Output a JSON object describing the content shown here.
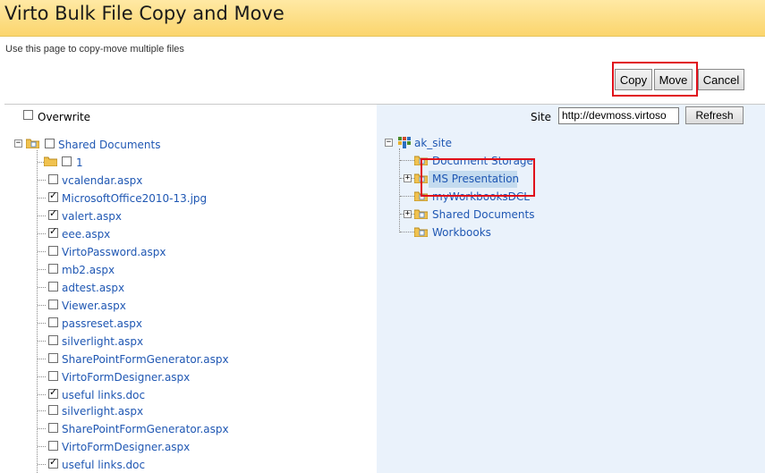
{
  "title": "Virto Bulk File Copy and Move",
  "subtitle": "Use this page to copy-move multiple files",
  "buttons": {
    "copy": "Copy",
    "move": "Move",
    "cancel": "Cancel"
  },
  "overwrite": {
    "label": "Overwrite",
    "checked": false
  },
  "site": {
    "label": "Site",
    "value": "http://devmoss.virtoso",
    "refresh": "Refresh"
  },
  "left_tree": {
    "root": "Shared Documents",
    "folder_1": "1",
    "files": [
      {
        "name": "vcalendar.aspx",
        "checked": false
      },
      {
        "name": "MicrosoftOffice2010-13.jpg",
        "checked": true
      },
      {
        "name": "valert.aspx",
        "checked": true
      },
      {
        "name": "eee.aspx",
        "checked": true
      },
      {
        "name": "VirtoPassword.aspx",
        "checked": false
      },
      {
        "name": "mb2.aspx",
        "checked": false
      },
      {
        "name": "adtest.aspx",
        "checked": false
      },
      {
        "name": "Viewer.aspx",
        "checked": false
      },
      {
        "name": "passreset.aspx",
        "checked": false
      },
      {
        "name": "silverlight.aspx",
        "checked": false
      },
      {
        "name": "SharePointFormGenerator.aspx",
        "checked": false
      },
      {
        "name": "VirtoFormDesigner.aspx",
        "checked": false
      },
      {
        "name": "useful links.doc",
        "checked": true
      },
      {
        "name": "silverlight.aspx",
        "checked": false
      },
      {
        "name": "SharePointFormGenerator.aspx",
        "checked": false
      },
      {
        "name": "VirtoFormDesigner.aspx",
        "checked": false
      },
      {
        "name": "useful links.doc",
        "checked": true
      }
    ]
  },
  "right_tree": {
    "root": "ak_site",
    "items": [
      "Document Storage",
      "MS Presentation",
      "myWorkbooksDCL",
      "Shared Documents",
      "Workbooks"
    ]
  },
  "colors": {
    "link": "#1f57b3",
    "highlight": "#e0101a",
    "title_bar": "#fbd56d"
  }
}
